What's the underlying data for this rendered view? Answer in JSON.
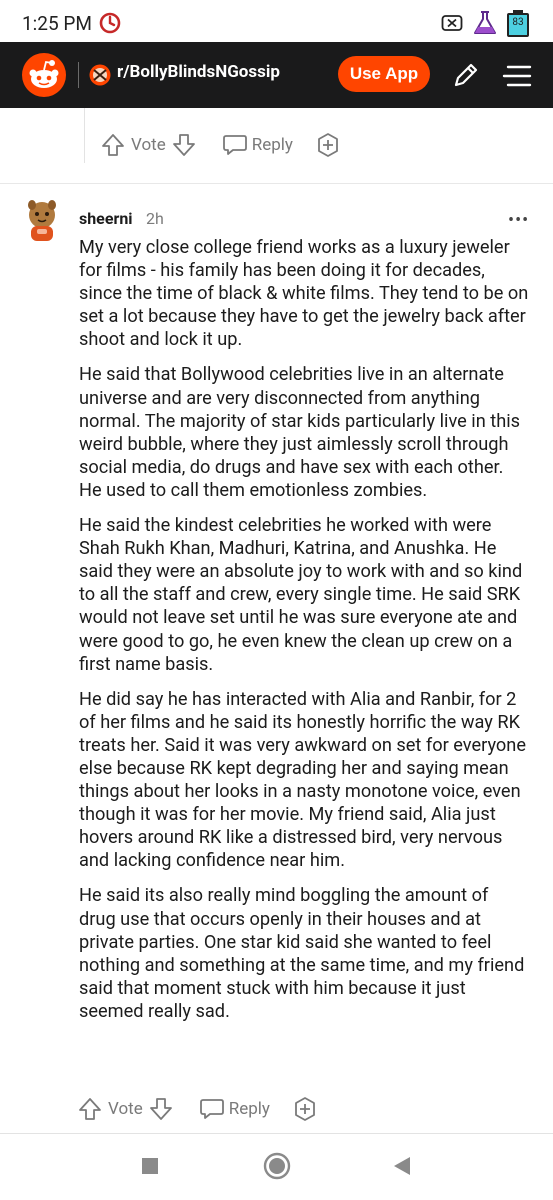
{
  "status": {
    "time": "1:25 PM",
    "battery": "83"
  },
  "header": {
    "subreddit": "r/BollyBlindsNGossip",
    "use_app": "Use App"
  },
  "prev_actions": {
    "vote": "Vote",
    "reply": "Reply"
  },
  "comment": {
    "username": "sheerni",
    "time": "2h",
    "more": "•••",
    "paragraphs": [
      "My very close college friend works as a luxury jeweler for films - his family has been doing it for decades, since the time of black & white films. They tend to be on set a lot because they have to get the jewelry back after shoot and lock it up.",
      "He said that Bollywood celebrities live in an alternate universe and are very disconnected from anything normal. The majority of star kids particularly live in this weird bubble, where they just aimlessly scroll through social media, do drugs and have sex with each other. He used to call them emotionless zombies.",
      "He said the kindest celebrities he worked with were Shah Rukh Khan, Madhuri, Katrina, and Anushka. He said they were an absolute joy to work with and so kind to all the staff and crew, every single time. He said SRK would not leave set until he was sure everyone ate and were good to go, he even knew the clean up crew on a first name basis.",
      "He did say he has interacted with Alia and Ranbir, for 2 of her films and he said its honestly horrific the way RK treats her. Said it was very awkward on set for everyone else because RK kept degrading her and saying mean things about her looks in a nasty monotone voice, even though it was for her movie. My friend said, Alia just hovers around RK like a distressed bird, very nervous and lacking confidence near him.",
      "He said its also really mind boggling the amount of drug use that occurs openly in their houses and at private parties. One star kid said she wanted to feel nothing and something at the same time, and my friend said that moment stuck with him because it just seemed really sad."
    ],
    "vote": "Vote",
    "reply": "Reply"
  },
  "colors": {
    "header_bg": "#1a1a1b",
    "accent": "#ff4500",
    "muted": "#7a7a7a"
  }
}
